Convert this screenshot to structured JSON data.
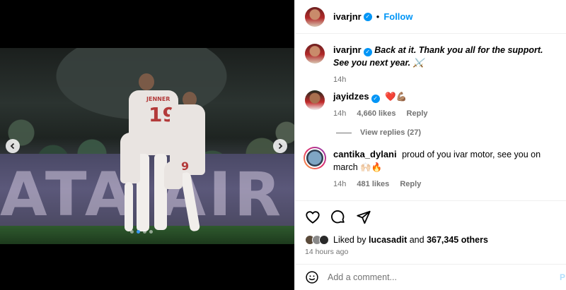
{
  "media": {
    "board_text": "ATA AIR",
    "jersey_name": "JENNER",
    "jersey_number": "19",
    "back_number": "9",
    "prev_icon": "chevron-left-icon",
    "next_icon": "chevron-right-icon",
    "carousel_dots": 4,
    "carousel_active": 1
  },
  "header": {
    "username": "ivarjnr",
    "separator": "•",
    "follow_label": "Follow"
  },
  "caption": {
    "username": "ivarjnr",
    "text": "Back at it. Thank you all for the support. See you next year. ⚔️",
    "time": "14h"
  },
  "comments": [
    {
      "username": "jayidzes",
      "text": "❤️💪🏽",
      "time": "14h",
      "likes": "4,660 likes",
      "reply_label": "Reply",
      "view_replies": "View replies (27)"
    },
    {
      "username": "cantika_dylani",
      "text": "proud of you ivar motor, see you on march 🙌🏻🔥",
      "time": "14h",
      "likes": "481 likes",
      "reply_label": "Reply"
    }
  ],
  "actions": {
    "like_icon": "heart-icon",
    "comment_icon": "comment-icon",
    "share_icon": "share-icon"
  },
  "likes": {
    "prefix": "Liked by",
    "user": "lucasadit",
    "middle": "and",
    "count": "367,345 others"
  },
  "timestamp": "14 hours ago",
  "add_comment": {
    "emoji_icon": "emoji-icon",
    "placeholder": "Add a comment...",
    "post_label": "P"
  },
  "colors": {
    "accent": "#0095f6",
    "muted": "#737373",
    "border": "#efefef"
  }
}
